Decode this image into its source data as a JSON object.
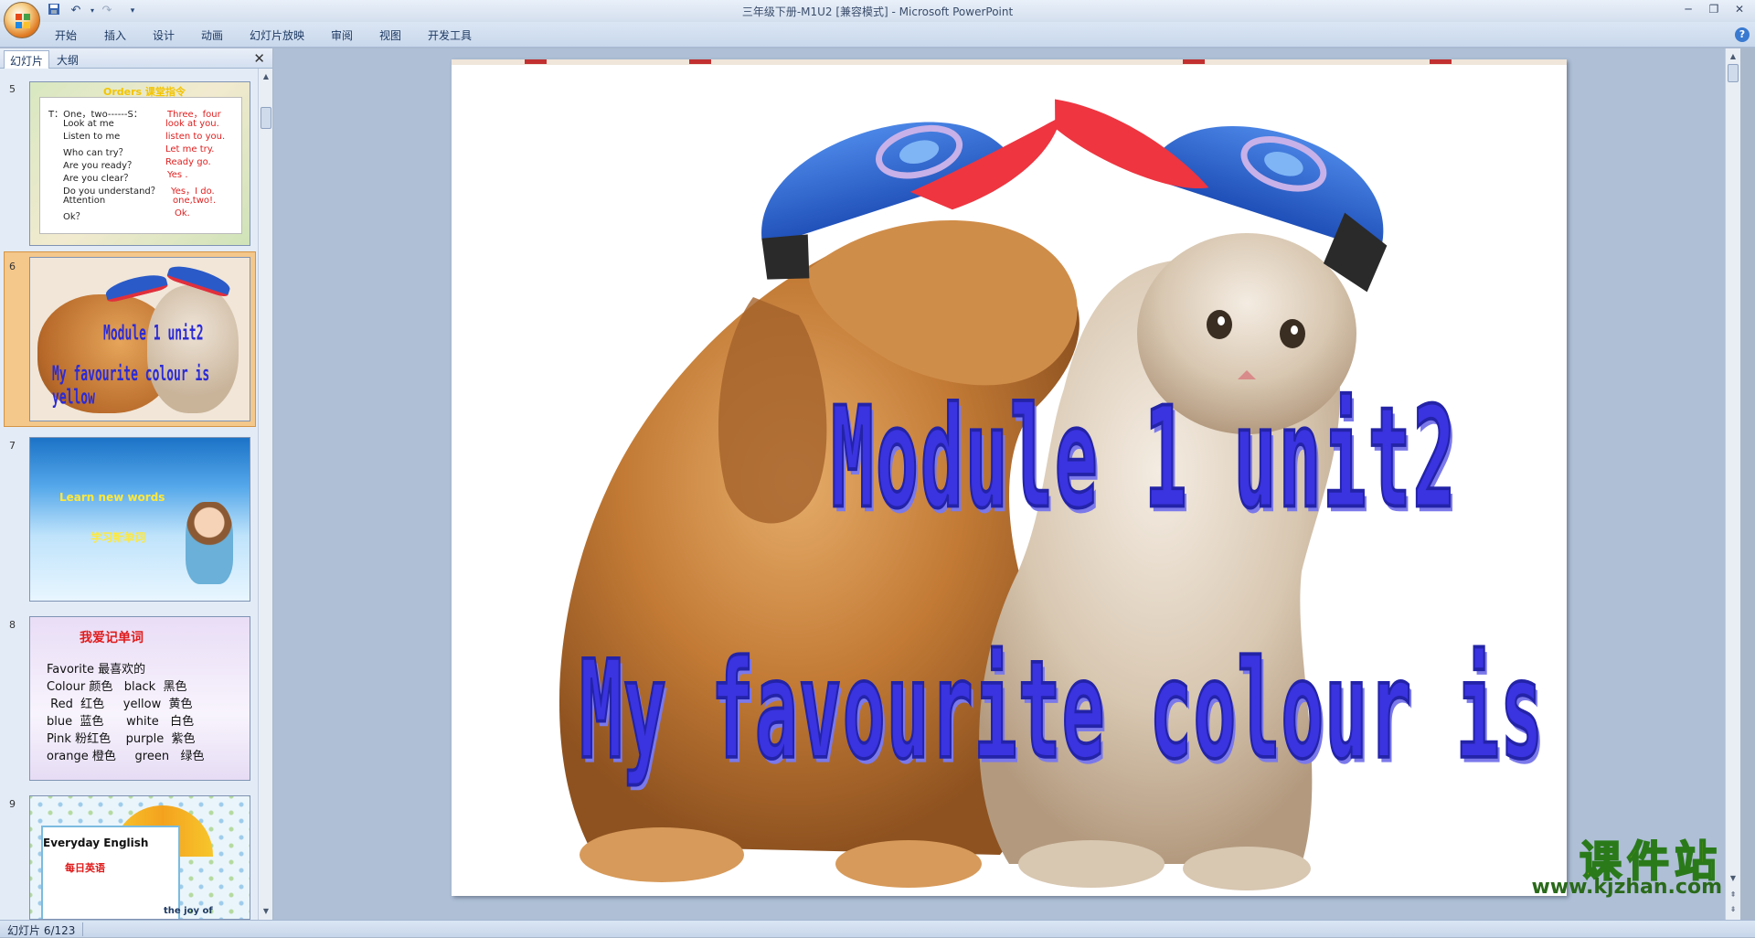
{
  "window": {
    "title": "三年级下册-M1U2 [兼容模式] - Microsoft PowerPoint"
  },
  "ribbon": {
    "tabs": [
      "开始",
      "插入",
      "设计",
      "动画",
      "幻灯片放映",
      "审阅",
      "视图",
      "开发工具"
    ]
  },
  "pane": {
    "tabs": [
      "幻灯片",
      "大纲"
    ],
    "close": "✕"
  },
  "thumbnails": {
    "numbers": [
      "5",
      "6",
      "7",
      "8",
      "9"
    ],
    "slide5": {
      "title": "Orders 课堂指令",
      "rows": [
        {
          "left": "T：One，two------S：",
          "right": "Three，four"
        },
        {
          "left": "Look at me",
          "right": "look at you."
        },
        {
          "left": "Listen to me",
          "right": "listen to you."
        },
        {
          "left": "Who can try？",
          "right": "Let me try."
        },
        {
          "left": "Are you ready？",
          "right": "Ready go."
        },
        {
          "left": "Are you clear？",
          "right": "Yes ."
        },
        {
          "left": "Do you understand？",
          "right": "Yes，I do."
        },
        {
          "left": "Attention",
          "right": "one,two!."
        },
        {
          "left": "Ok？",
          "right": "Ok."
        }
      ]
    },
    "slide6": {
      "line1": "Module 1 unit2",
      "line2": "My favourite colour is yellow"
    },
    "slide7": {
      "line1": "Learn new words",
      "line2": "学习新单词"
    },
    "slide8": {
      "title": "我爱记单词",
      "lines": [
        "Favorite 最喜欢的",
        "Colour 颜色   black  黑色",
        " Red  红色     yellow  黄色",
        "blue  蓝色      white   白色",
        "Pink 粉红色    purple  紫色",
        "orange 橙色     green   绿色"
      ]
    },
    "slide9": {
      "line1": "Everyday  English",
      "line2": "每日英语",
      "caption": "the joy of"
    }
  },
  "slide": {
    "line1": "Module 1 unit2",
    "line2": "My  favourite  colour is  yellow"
  },
  "watermark": {
    "cn": "课件站",
    "url": "www.kjzhan.com"
  },
  "status": {
    "text": "幻灯片 6/123"
  }
}
